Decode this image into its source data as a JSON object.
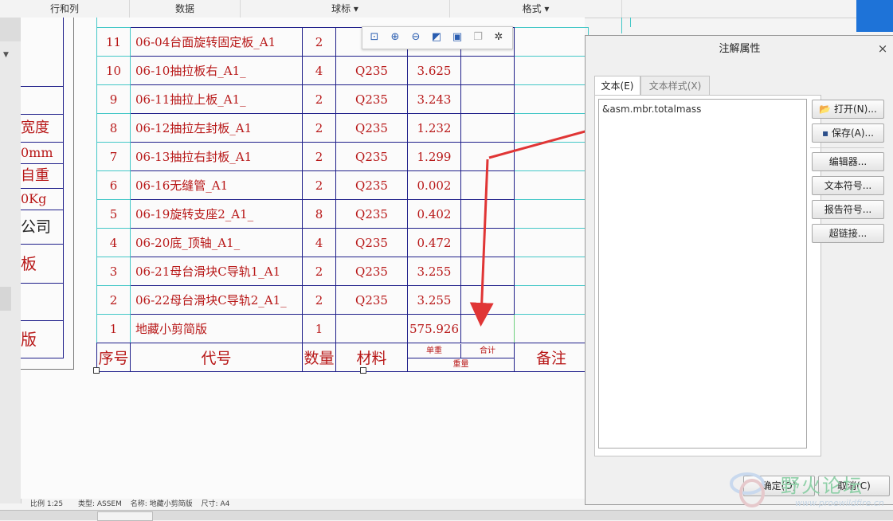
{
  "ribbon": {
    "groups": [
      "行和列",
      "数据",
      "球标 ▾",
      "格式 ▾"
    ]
  },
  "title_block": {
    "cells": [
      "宽度",
      "0mm",
      "自重",
      "0Kg",
      "公司",
      "板",
      "",
      "版"
    ]
  },
  "bom": {
    "rows": [
      {
        "seq": "11",
        "code": "06-04台面旋转固定板_A1",
        "qty": "2",
        "mat": "Q",
        "unit": "",
        "total": ""
      },
      {
        "seq": "10",
        "code": "06-10抽拉板右_A1_",
        "qty": "4",
        "mat": "Q235",
        "unit": "3.625",
        "total": ""
      },
      {
        "seq": "9",
        "code": "06-11抽拉上板_A1_",
        "qty": "2",
        "mat": "Q235",
        "unit": "3.243",
        "total": ""
      },
      {
        "seq": "8",
        "code": "06-12抽拉左封板_A1",
        "qty": "2",
        "mat": "Q235",
        "unit": "1.232",
        "total": ""
      },
      {
        "seq": "7",
        "code": "06-13抽拉右封板_A1",
        "qty": "2",
        "mat": "Q235",
        "unit": "1.299",
        "total": ""
      },
      {
        "seq": "6",
        "code": "06-16无缝管_A1",
        "qty": "2",
        "mat": "Q235",
        "unit": "0.002",
        "total": ""
      },
      {
        "seq": "5",
        "code": "06-19旋转支座2_A1_",
        "qty": "8",
        "mat": "Q235",
        "unit": "0.402",
        "total": ""
      },
      {
        "seq": "4",
        "code": "06-20底_顶轴_A1_",
        "qty": "4",
        "mat": "Q235",
        "unit": "0.472",
        "total": ""
      },
      {
        "seq": "3",
        "code": "06-21母台滑块C导轨1_A1",
        "qty": "2",
        "mat": "Q235",
        "unit": "3.255",
        "total": ""
      },
      {
        "seq": "2",
        "code": "06-22母台滑块C导轨2_A1_",
        "qty": "2",
        "mat": "Q235",
        "unit": "3.255",
        "total": ""
      },
      {
        "seq": "1",
        "code": "地藏小剪简版",
        "qty": "1",
        "mat": "",
        "unit": "575.926",
        "total": ""
      }
    ],
    "header": {
      "seq": "序号",
      "code": "代号",
      "qty": "数量",
      "mat": "材料",
      "unit": "单重",
      "total": "合计",
      "weight": "重量",
      "remark": "备注"
    }
  },
  "minitoolbar": {
    "icons": [
      "zoom-fit-icon",
      "zoom-in-icon",
      "zoom-out-icon",
      "shade-icon",
      "view-cube-icon",
      "copy-icon",
      "sparkle-icon"
    ]
  },
  "dialog": {
    "title": "注解属性",
    "close": "×",
    "tabs": {
      "text": "文本(E)",
      "style": "文本样式(X)"
    },
    "text_value": "&asm.mbr.totalmass",
    "buttons": {
      "open": "打开(N)...",
      "save": "保存(A)...",
      "editor": "编辑器...",
      "text_symbol": "文本符号...",
      "report_symbol": "报告符号...",
      "hyperlink": "超链接...",
      "ok": "确定(O)",
      "cancel": "取消(C)"
    }
  },
  "status": {
    "scale": "比例 1:25",
    "type": "类型: ASSEM",
    "name": "名称: 地藏小剪简版",
    "size": "尺寸: A4"
  },
  "watermark": {
    "title": "野火论坛",
    "url": "www.proewildfire.cn"
  },
  "colors": {
    "accent": "#1e73d8",
    "annotation_arrow": "#e03535",
    "table_text": "#b81818",
    "table_line": "#1f1f8a",
    "selection": "#43c7c7"
  }
}
